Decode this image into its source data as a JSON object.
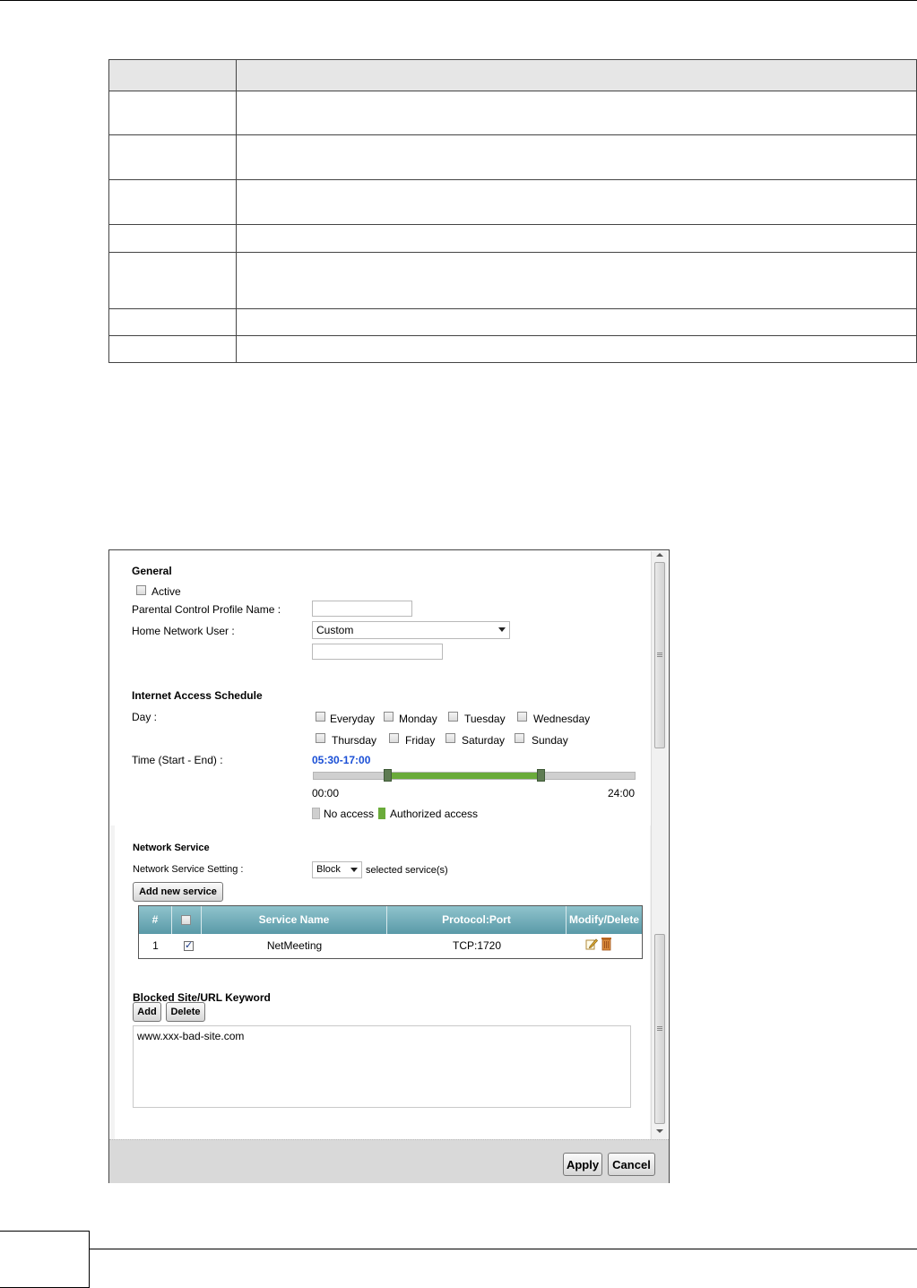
{
  "doc_table": {
    "rows": 8
  },
  "general": {
    "title": "General",
    "active_label": "Active",
    "profile_name_label": "Parental Control Profile Name :",
    "profile_name_value": "",
    "home_user_label": "Home Network User :",
    "home_user_selected": "Custom",
    "custom_mac_value": ""
  },
  "schedule": {
    "title": "Internet Access Schedule",
    "day_label": "Day :",
    "days": [
      "Everyday",
      "Monday",
      "Tuesday",
      "Wednesday",
      "Thursday",
      "Friday",
      "Saturday",
      "Sunday"
    ],
    "time_label": "Time (Start - End) :",
    "time_range": "05:30-17:00",
    "start_fraction": 0.229,
    "end_fraction": 0.708,
    "scale_start": "00:00",
    "scale_end": "24:00",
    "legend_no_access": "No access",
    "legend_authorized": "Authorized access",
    "accent_color": "#1a4fd6",
    "fill_color": "#6aab3a"
  },
  "network_service": {
    "title": "Network Service",
    "setting_label": "Network Service Setting :",
    "setting_value": "Block",
    "setting_suffix": "selected service(s)",
    "add_button": "Add new service",
    "columns": [
      "#",
      "",
      "Service Name",
      "Protocol:Port",
      "Modify/Delete"
    ],
    "rows": [
      {
        "index": "1",
        "checked": true,
        "name": "NetMeeting",
        "protocol_port": "TCP:1720"
      }
    ]
  },
  "blocked": {
    "title": "Blocked Site/URL Keyword",
    "add_button": "Add",
    "delete_button": "Delete",
    "entries": "www.xxx-bad-site.com"
  },
  "footer": {
    "apply": "Apply",
    "cancel": "Cancel"
  }
}
